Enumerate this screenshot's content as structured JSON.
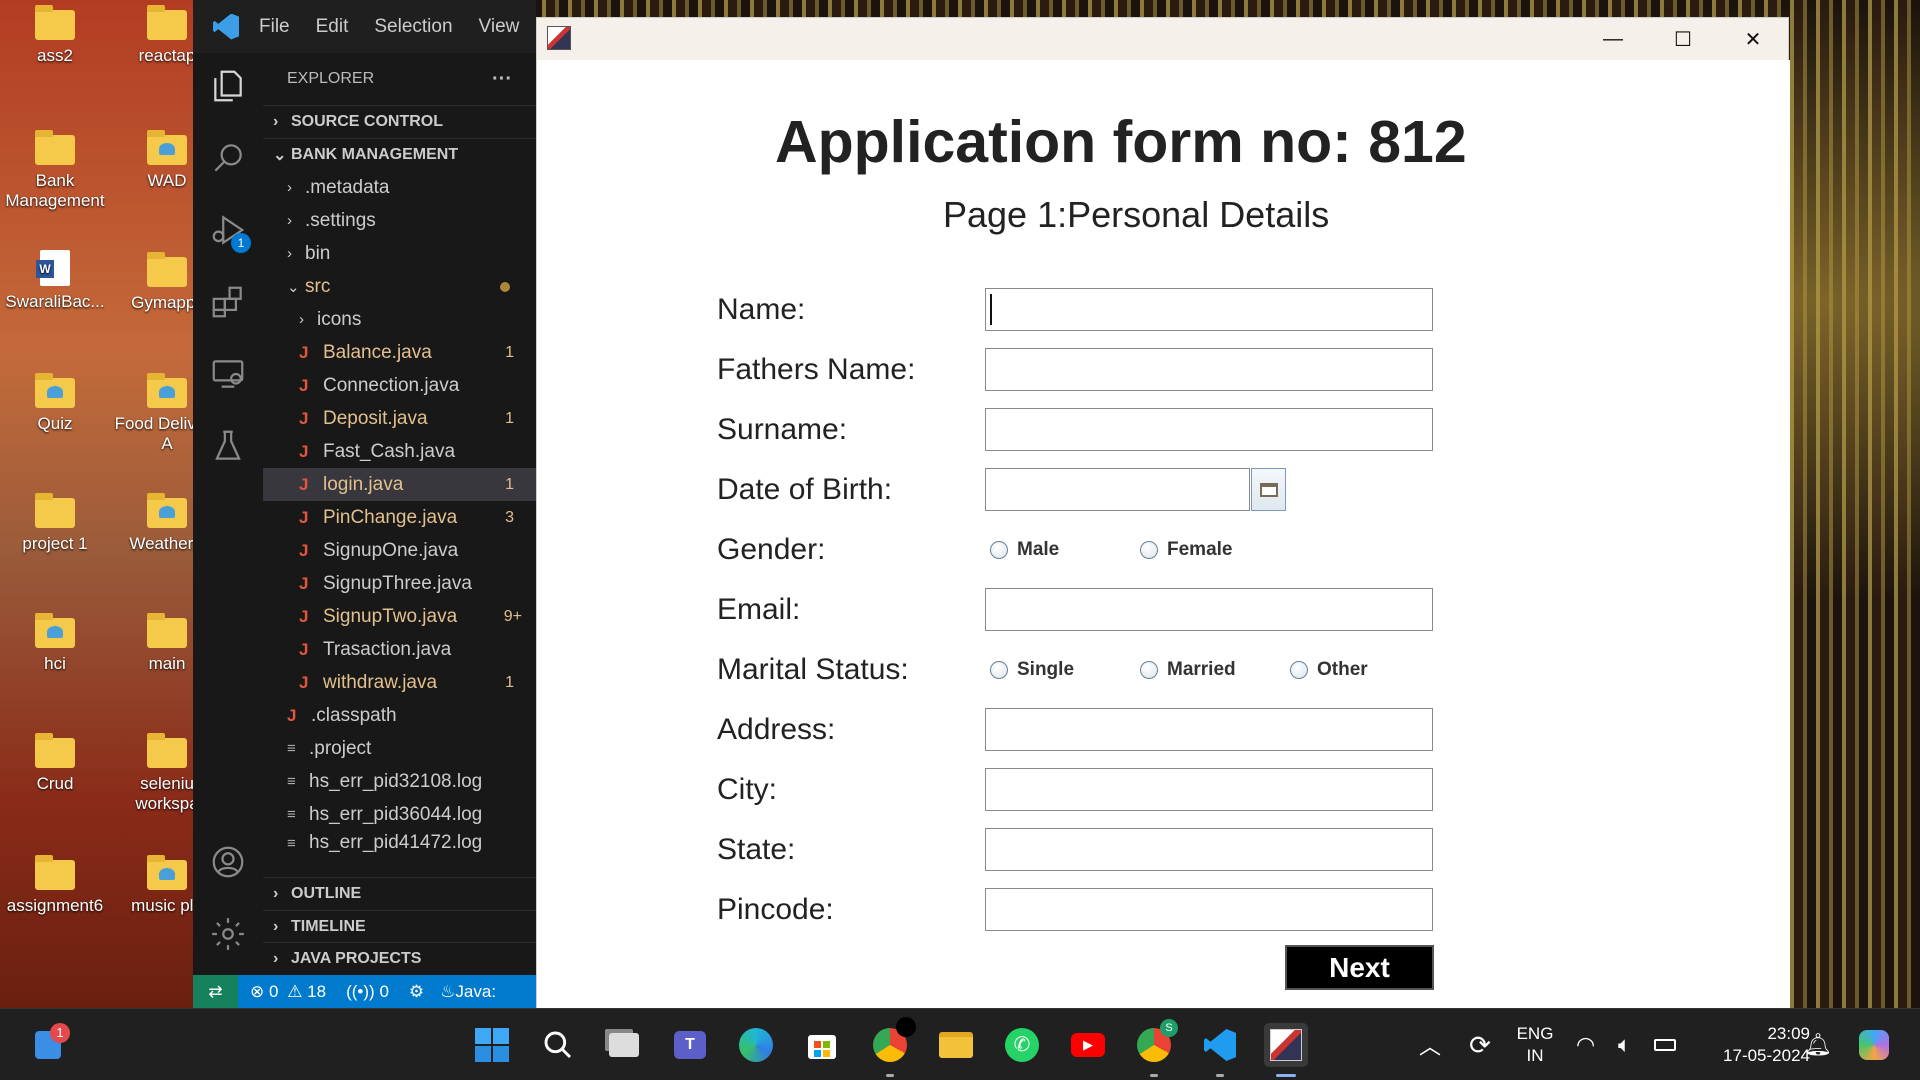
{
  "desktop": {
    "icons": [
      {
        "label": "ass2"
      },
      {
        "label": "reactap"
      },
      {
        "label": "Bank Management"
      },
      {
        "label": "WAD"
      },
      {
        "label": "SwaraliBac..."
      },
      {
        "label": "Gymappli"
      },
      {
        "label": "Quiz"
      },
      {
        "label": "Food Delivery A"
      },
      {
        "label": "project 1"
      },
      {
        "label": "WeatherA"
      },
      {
        "label": "hci"
      },
      {
        "label": "main"
      },
      {
        "label": "Crud"
      },
      {
        "label": "seleniu workspa"
      },
      {
        "label": "assignment6"
      },
      {
        "label": "music pla"
      }
    ]
  },
  "vscode": {
    "menu": {
      "file": "File",
      "edit": "Edit",
      "selection": "Selection",
      "view": "View"
    },
    "explorer_title": "EXPLORER",
    "more": "···",
    "sections": {
      "source_control": "SOURCE CONTROL",
      "project": "BANK MANAGEMENT",
      "outline": "OUTLINE",
      "timeline": "TIMELINE",
      "java_projects": "JAVA PROJECTS"
    },
    "run_badge": "1",
    "tree": [
      {
        "label": ".metadata"
      },
      {
        "label": ".settings"
      },
      {
        "label": "bin"
      },
      {
        "label": "src"
      },
      {
        "label": "icons"
      },
      {
        "label": "Balance.java",
        "badge": "1"
      },
      {
        "label": "Connection.java"
      },
      {
        "label": "Deposit.java",
        "badge": "1"
      },
      {
        "label": "Fast_Cash.java"
      },
      {
        "label": "login.java",
        "badge": "1"
      },
      {
        "label": "PinChange.java",
        "badge": "3"
      },
      {
        "label": "SignupOne.java"
      },
      {
        "label": "SignupThree.java"
      },
      {
        "label": "SignupTwo.java",
        "badge": "9+"
      },
      {
        "label": "Trasaction.java"
      },
      {
        "label": "withdraw.java",
        "badge": "1"
      },
      {
        "label": ".classpath"
      },
      {
        "label": ".project"
      },
      {
        "label": "hs_err_pid32108.log"
      },
      {
        "label": "hs_err_pid36044.log"
      },
      {
        "label": "hs_err_pid41472.log"
      }
    ],
    "status": {
      "errors": "0",
      "warnings": "18",
      "ports": "0",
      "java": "Java:"
    }
  },
  "app": {
    "title": "Application form no: 812",
    "subtitle": "Page 1:Personal Details",
    "labels": {
      "name": "Name:",
      "fathers_name": "Fathers Name:",
      "surname": "Surname:",
      "dob": "Date of Birth:",
      "gender": "Gender:",
      "email": "Email:",
      "marital": "Marital Status:",
      "address": "Address:",
      "city": "City:",
      "state": "State:",
      "pincode": "Pincode:"
    },
    "values": {
      "name": "",
      "fathers_name": "",
      "surname": "",
      "dob": "",
      "email": "",
      "address": "",
      "city": "",
      "state": "",
      "pincode": ""
    },
    "gender_options": {
      "male": "Male",
      "female": "Female"
    },
    "marital_options": {
      "single": "Single",
      "married": "Married",
      "other": "Other"
    },
    "next_label": "Next"
  },
  "taskbar": {
    "widgets_badge": "1",
    "chrome_badge": "S",
    "lang": {
      "line1": "ENG",
      "line2": "IN"
    },
    "time": "23:09",
    "date": "17-05-2024"
  }
}
